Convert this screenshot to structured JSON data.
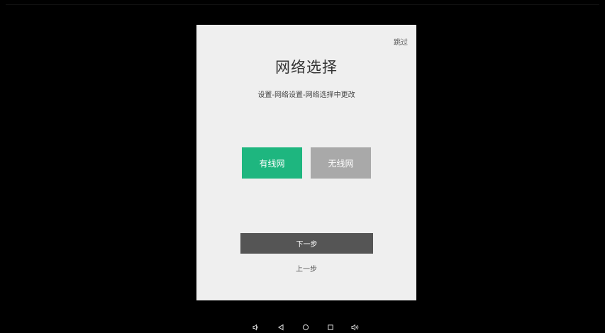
{
  "dialog": {
    "skip_label": "跳过",
    "title": "网络选择",
    "subtitle": "设置-网络设置-网络选择中更改",
    "options": [
      {
        "label": "有线网",
        "selected": true,
        "color": "#1eb67f"
      },
      {
        "label": "无线网",
        "selected": false,
        "color": "#a9a9a9"
      }
    ],
    "next_label": "下一步",
    "prev_label": "上一步"
  },
  "navbar": {
    "buttons": [
      {
        "icon": "volume-down-icon"
      },
      {
        "icon": "back-triangle-icon"
      },
      {
        "icon": "home-circle-icon"
      },
      {
        "icon": "recent-apps-square-icon"
      },
      {
        "icon": "volume-up-icon"
      }
    ]
  },
  "colors": {
    "background": "#000000",
    "panel": "#efefef",
    "accent": "#1eb67f",
    "next_button": "#555555"
  }
}
